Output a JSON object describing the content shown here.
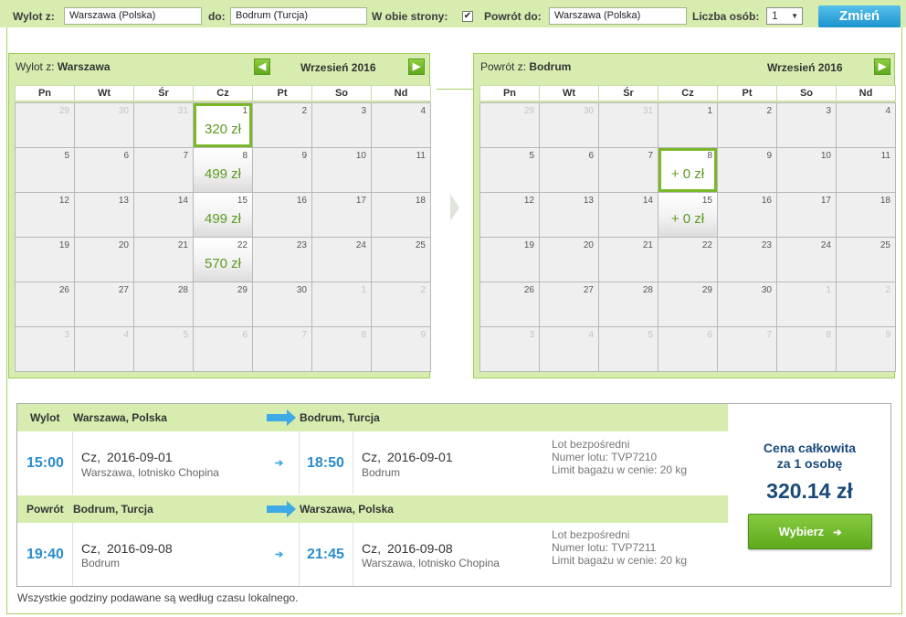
{
  "search": {
    "from_label": "Wylot z:",
    "from_value": "Warszawa (Polska)",
    "to_label": "do:",
    "to_value": "Bodrum (Turcja)",
    "roundtrip_label": "W obie strony:",
    "roundtrip_checked": "✔",
    "return_label": "Powrót do:",
    "return_value": "Warszawa (Polska)",
    "persons_label": "Liczba osób:",
    "persons_value": "1",
    "change_button": "Zmień"
  },
  "outbound_calendar": {
    "title_prefix": "Wylot z:",
    "title_city": "Warszawa",
    "month": "Wrzesień 2016",
    "weekdays": [
      "Pn",
      "Wt",
      "Śr",
      "Cz",
      "Pt",
      "So",
      "Nd"
    ],
    "days": [
      {
        "d": "29",
        "other": true
      },
      {
        "d": "30",
        "other": true
      },
      {
        "d": "31",
        "other": true
      },
      {
        "d": "1",
        "price": "320 zł",
        "selected": true
      },
      {
        "d": "2"
      },
      {
        "d": "3"
      },
      {
        "d": "4"
      },
      {
        "d": "5"
      },
      {
        "d": "6"
      },
      {
        "d": "7"
      },
      {
        "d": "8",
        "price": "499 zł"
      },
      {
        "d": "9"
      },
      {
        "d": "10"
      },
      {
        "d": "11"
      },
      {
        "d": "12"
      },
      {
        "d": "13"
      },
      {
        "d": "14"
      },
      {
        "d": "15",
        "price": "499 zł"
      },
      {
        "d": "16"
      },
      {
        "d": "17"
      },
      {
        "d": "18"
      },
      {
        "d": "19"
      },
      {
        "d": "20"
      },
      {
        "d": "21"
      },
      {
        "d": "22",
        "price": "570 zł"
      },
      {
        "d": "23"
      },
      {
        "d": "24"
      },
      {
        "d": "25"
      },
      {
        "d": "26"
      },
      {
        "d": "27"
      },
      {
        "d": "28"
      },
      {
        "d": "29"
      },
      {
        "d": "30"
      },
      {
        "d": "1",
        "other": true
      },
      {
        "d": "2",
        "other": true
      },
      {
        "d": "3",
        "other": true
      },
      {
        "d": "4",
        "other": true
      },
      {
        "d": "5",
        "other": true
      },
      {
        "d": "6",
        "other": true
      },
      {
        "d": "7",
        "other": true
      },
      {
        "d": "8",
        "other": true
      },
      {
        "d": "9",
        "other": true
      }
    ]
  },
  "return_calendar": {
    "title_prefix": "Powrót z:",
    "title_city": "Bodrum",
    "month": "Wrzesień 2016",
    "weekdays": [
      "Pn",
      "Wt",
      "Śr",
      "Cz",
      "Pt",
      "So",
      "Nd"
    ],
    "days": [
      {
        "d": "29",
        "other": true
      },
      {
        "d": "30",
        "other": true
      },
      {
        "d": "31",
        "other": true
      },
      {
        "d": "1"
      },
      {
        "d": "2"
      },
      {
        "d": "3"
      },
      {
        "d": "4"
      },
      {
        "d": "5"
      },
      {
        "d": "6"
      },
      {
        "d": "7"
      },
      {
        "d": "8",
        "price": "+ 0 zł",
        "selected": true
      },
      {
        "d": "9"
      },
      {
        "d": "10"
      },
      {
        "d": "11"
      },
      {
        "d": "12"
      },
      {
        "d": "13"
      },
      {
        "d": "14"
      },
      {
        "d": "15",
        "price": "+ 0 zł"
      },
      {
        "d": "16"
      },
      {
        "d": "17"
      },
      {
        "d": "18"
      },
      {
        "d": "19"
      },
      {
        "d": "20"
      },
      {
        "d": "21"
      },
      {
        "d": "22"
      },
      {
        "d": "23"
      },
      {
        "d": "24"
      },
      {
        "d": "25"
      },
      {
        "d": "26"
      },
      {
        "d": "27"
      },
      {
        "d": "28"
      },
      {
        "d": "29"
      },
      {
        "d": "30"
      },
      {
        "d": "1",
        "other": true
      },
      {
        "d": "2",
        "other": true
      },
      {
        "d": "3",
        "other": true
      },
      {
        "d": "4",
        "other": true
      },
      {
        "d": "5",
        "other": true
      },
      {
        "d": "6",
        "other": true
      },
      {
        "d": "7",
        "other": true
      },
      {
        "d": "8",
        "other": true
      },
      {
        "d": "9",
        "other": true
      }
    ]
  },
  "outbound_leg": {
    "label": "Wylot",
    "from": "Warszawa, Polska",
    "to": "Bodrum, Turcja",
    "dep_time": "15:00",
    "dep_day": "Cz,",
    "dep_date": "2016-09-01",
    "dep_airport": "Warszawa, lotnisko Chopina",
    "arr_time": "18:50",
    "arr_day": "Cz,",
    "arr_date": "2016-09-01",
    "arr_airport": "Bodrum",
    "info_direct": "Lot bezpośredni",
    "info_flight": "Numer lotu: TVP7210",
    "info_baggage": "Limit bagażu w cenie: 20 kg"
  },
  "return_leg": {
    "label": "Powrót",
    "from": "Bodrum, Turcja",
    "to": "Warszawa, Polska",
    "dep_time": "19:40",
    "dep_day": "Cz,",
    "dep_date": "2016-09-08",
    "dep_airport": "Bodrum",
    "arr_time": "21:45",
    "arr_day": "Cz,",
    "arr_date": "2016-09-08",
    "arr_airport": "Warszawa, lotnisko Chopina",
    "info_direct": "Lot bezpośredni",
    "info_flight": "Numer lotu: TVP7211",
    "info_baggage": "Limit bagażu w cenie: 20 kg"
  },
  "price": {
    "label_line1": "Cena całkowita",
    "label_line2": "za 1 osobę",
    "value": "320.14 zł",
    "choose_button": "Wybierz"
  },
  "footnote": "Wszystkie godziny podawane są według czasu lokalnego.",
  "colors": {
    "accent_green": "#7bb829",
    "panel_green": "#d7ecaf",
    "time_blue": "#2a8ccf",
    "price_navy": "#1a4a7a",
    "button_blue": "#1d93cf"
  }
}
